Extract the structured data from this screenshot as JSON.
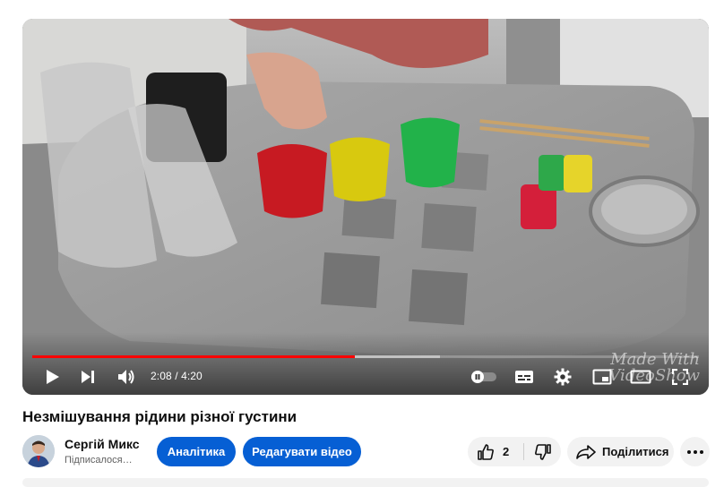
{
  "player": {
    "current_time": "2:08",
    "duration": "4:20",
    "time_separator": "/",
    "progress_played": 0.484,
    "progress_buffered": 0.612,
    "watermark_line1": "Made With",
    "watermark_line2": "VideoShow",
    "progress_color": "#ff0000"
  },
  "video": {
    "title": "Незмішування рідини різної густини"
  },
  "channel": {
    "name": "Сергій Микс",
    "subscription": "Підписалося…"
  },
  "actions": {
    "analytics_label": "Аналітика",
    "edit_label": "Редагувати відео",
    "like_count": "2",
    "share_label": "Поділитися",
    "accent_color": "#065fd4"
  }
}
